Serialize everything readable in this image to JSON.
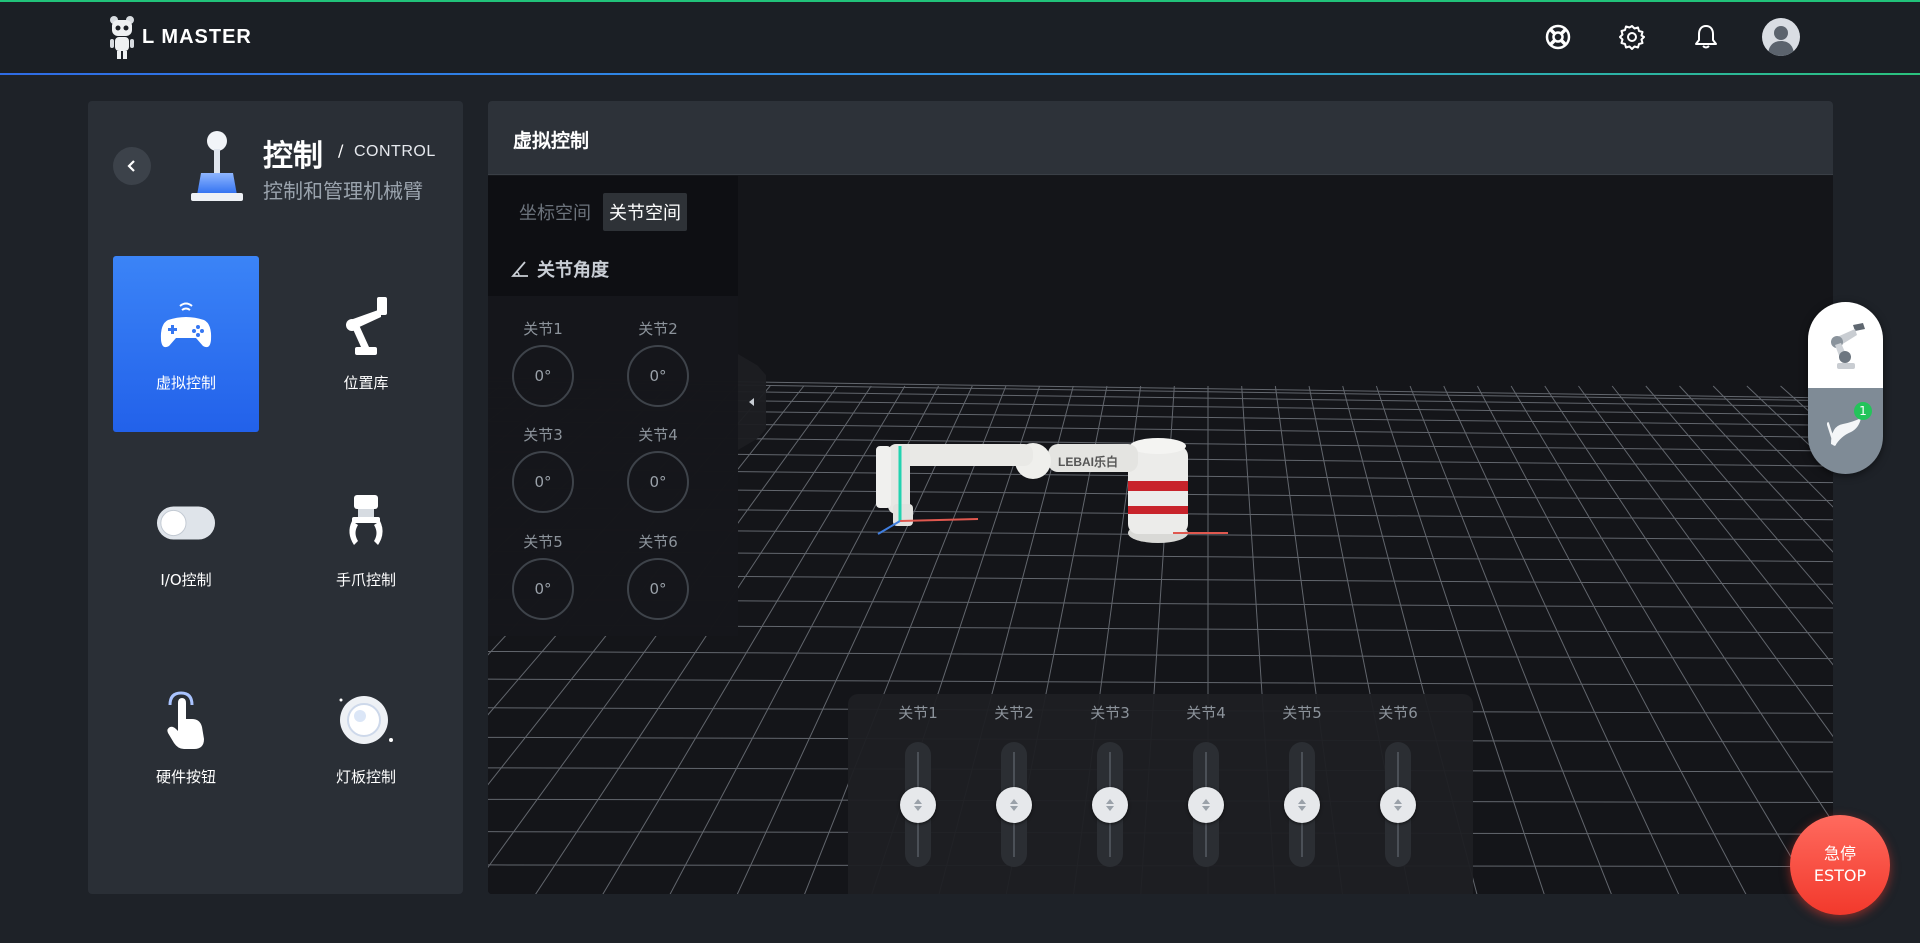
{
  "brand": {
    "logo_text": "L MASTER"
  },
  "header_icons": [
    "support-icon",
    "settings-icon",
    "notification-icon",
    "user-avatar"
  ],
  "left": {
    "title": "控制",
    "separator": "/",
    "title_en": "CONTROL",
    "subtitle": "控制和管理机械臂",
    "menu": [
      {
        "label": "虚拟控制",
        "icon": "gamepad-icon",
        "active": true
      },
      {
        "label": "位置库",
        "icon": "robot-arm-icon",
        "active": false
      },
      {
        "label": "I/O控制",
        "icon": "toggle-icon",
        "active": false
      },
      {
        "label": "手爪控制",
        "icon": "gripper-icon",
        "active": false
      },
      {
        "label": "硬件按钮",
        "icon": "tap-hand-icon",
        "active": false
      },
      {
        "label": "灯板控制",
        "icon": "light-ball-icon",
        "active": false
      }
    ]
  },
  "main": {
    "title": "虚拟控制",
    "tabs": [
      {
        "label": "坐标空间",
        "active": false
      },
      {
        "label": "关节空间",
        "active": true
      }
    ],
    "angles_title": "关节角度",
    "joints": [
      {
        "label": "关节1",
        "value": "0°"
      },
      {
        "label": "关节2",
        "value": "0°"
      },
      {
        "label": "关节3",
        "value": "0°"
      },
      {
        "label": "关节4",
        "value": "0°"
      },
      {
        "label": "关节5",
        "value": "0°"
      },
      {
        "label": "关节6",
        "value": "0°"
      }
    ],
    "sliders": [
      "关节1",
      "关节2",
      "关节3",
      "关节4",
      "关节5",
      "关节6"
    ],
    "robot_brand": "LEBAI乐白"
  },
  "float_panel": {
    "badge": "1"
  },
  "estop": {
    "line1": "急停",
    "line2": "ESTOP"
  },
  "colors": {
    "accent": "#2f6ce5",
    "estop": "#f2392c",
    "badge": "#23c45a"
  }
}
